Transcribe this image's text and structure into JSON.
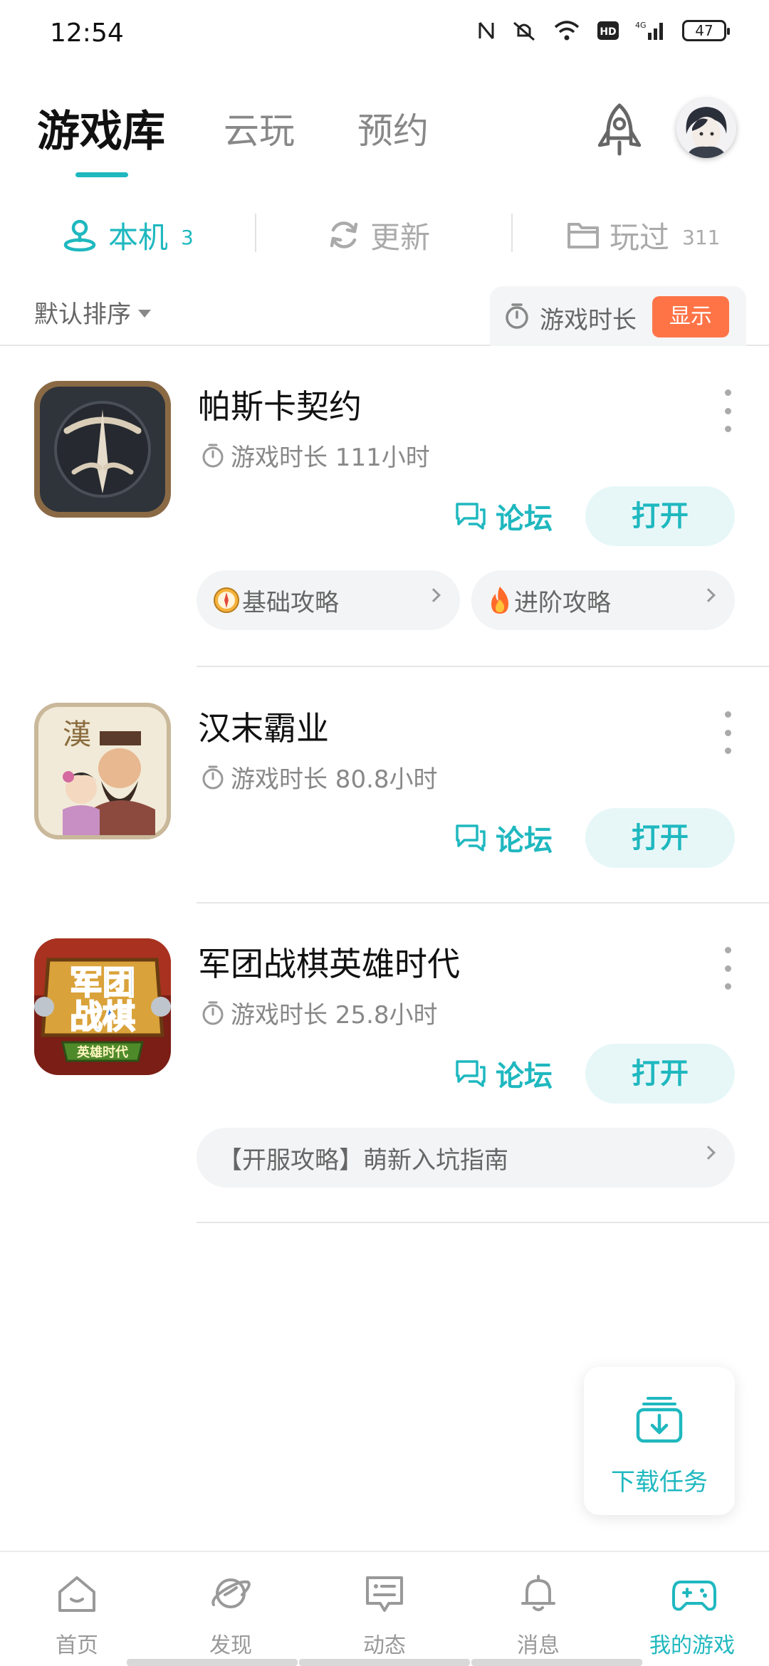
{
  "status_bar": {
    "time": "12:54",
    "battery": "47"
  },
  "top_tabs": [
    "游戏库",
    "云玩",
    "预约"
  ],
  "sub_tabs": [
    {
      "label": "本机",
      "count": "3"
    },
    {
      "label": "更新",
      "count": ""
    },
    {
      "label": "玩过",
      "count": "311"
    }
  ],
  "sort": {
    "label": "默认排序"
  },
  "playtime_toggle": {
    "label": "游戏时长",
    "button": "显示"
  },
  "games": [
    {
      "name": "帕斯卡契约",
      "time": "游戏时长 111小时",
      "forum": "论坛",
      "open": "打开",
      "guides": [
        "基础攻略",
        "进阶攻略"
      ]
    },
    {
      "name": "汉末霸业",
      "time": "游戏时长 80.8小时",
      "forum": "论坛",
      "open": "打开",
      "guides": []
    },
    {
      "name": "军团战棋英雄时代",
      "time": "游戏时长 25.8小时",
      "forum": "论坛",
      "open": "打开",
      "guides": [
        "【开服攻略】萌新入坑指南"
      ],
      "icon_text": [
        "军团",
        "战棋",
        "英雄时代"
      ]
    }
  ],
  "download": {
    "label": "下载任务"
  },
  "bottom_nav": [
    "首页",
    "发现",
    "动态",
    "消息",
    "我的游戏"
  ],
  "colors": {
    "accent": "#1fb8bf",
    "badge_orange": "#ff7447"
  }
}
